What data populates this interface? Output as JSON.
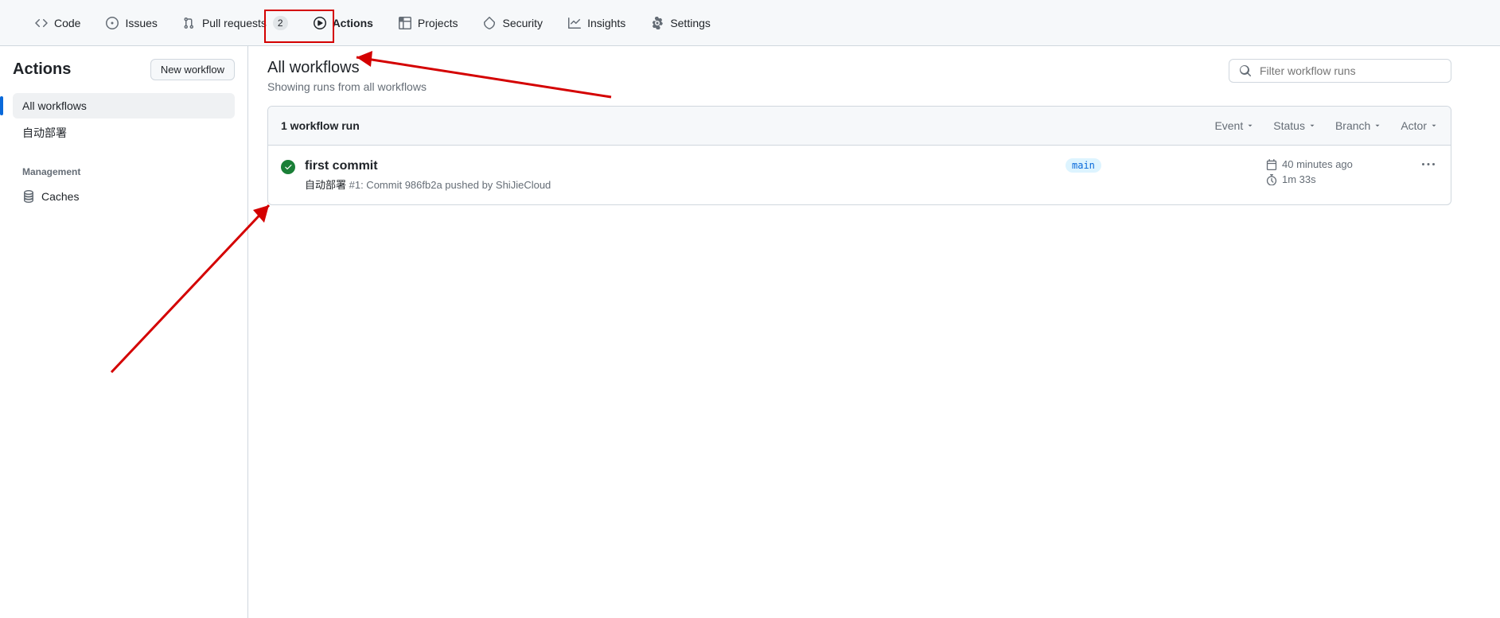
{
  "nav": {
    "code": "Code",
    "issues": "Issues",
    "pull_requests": "Pull requests",
    "pull_requests_count": "2",
    "actions": "Actions",
    "projects": "Projects",
    "security": "Security",
    "insights": "Insights",
    "settings": "Settings"
  },
  "sidebar": {
    "title": "Actions",
    "new_workflow": "New workflow",
    "items": [
      {
        "label": "All workflows"
      },
      {
        "label": "自动部署"
      }
    ],
    "management_heading": "Management",
    "caches": "Caches"
  },
  "main": {
    "title": "All workflows",
    "subtitle": "Showing runs from all workflows",
    "search_placeholder": "Filter workflow runs",
    "count_label": "1 workflow run",
    "filters": {
      "event": "Event",
      "status": "Status",
      "branch": "Branch",
      "actor": "Actor"
    },
    "runs": [
      {
        "title": "first commit",
        "sub_prefix": "自动部署",
        "sub_rest": " #1: Commit 986fb2a pushed by ShiJieCloud",
        "branch": "main",
        "time": "40 minutes ago",
        "duration": "1m 33s"
      }
    ]
  }
}
